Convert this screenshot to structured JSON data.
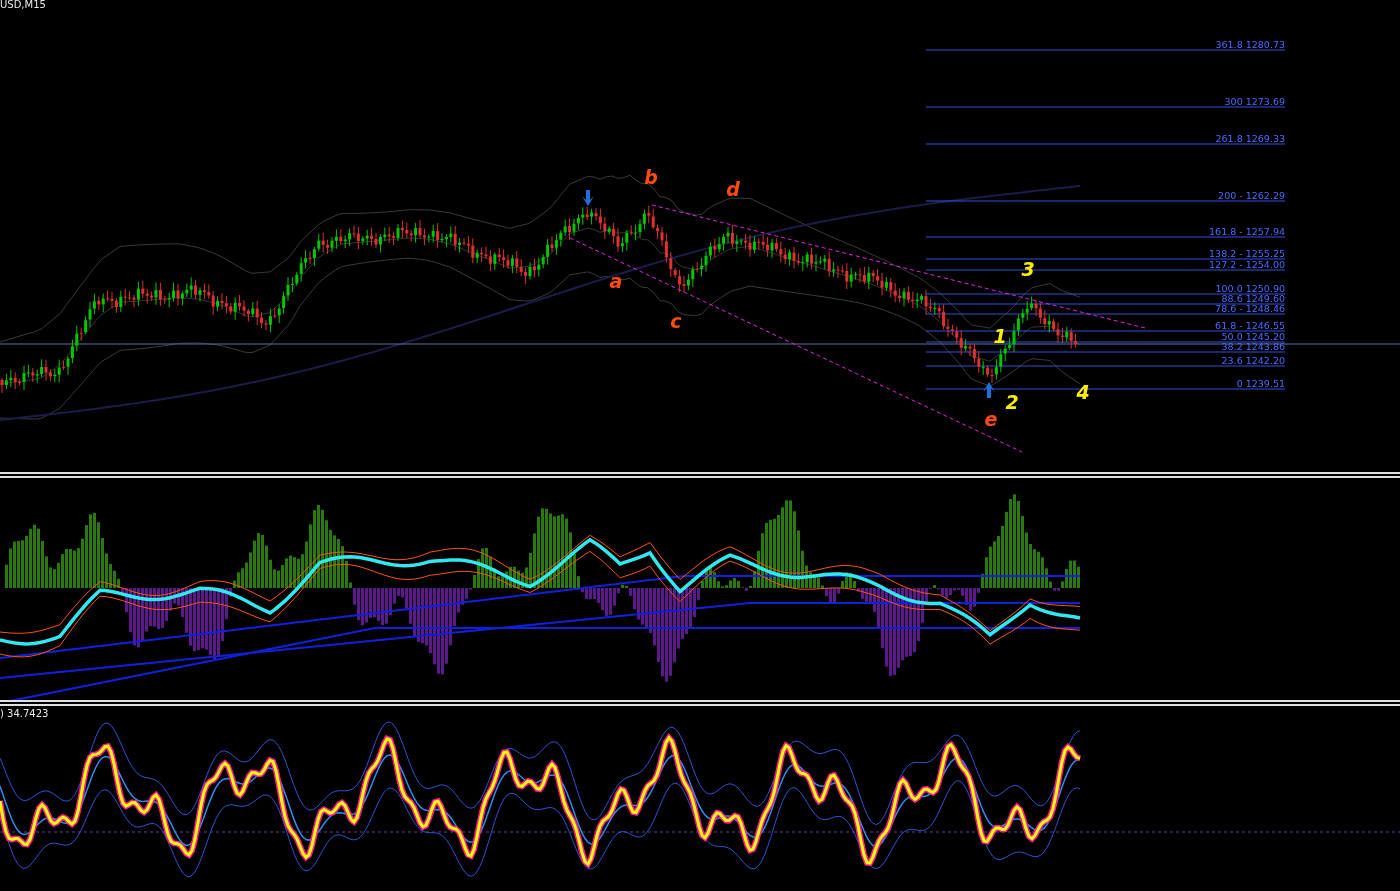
{
  "price_chart": {
    "symbol_label": "USD,M15",
    "fibonacci_levels": [
      {
        "label": "361.8 1280.73"
      },
      {
        "label": "300 1273.69"
      },
      {
        "label": "261.8 1269.33"
      },
      {
        "label": "200 - 1262.29"
      },
      {
        "label": "161.8 -  1257.94"
      },
      {
        "label": "138.2 - 1255.25"
      },
      {
        "label": "127.2 - 1254.00"
      },
      {
        "label": "100.0 1250.90"
      },
      {
        "label": "88.6 1249.60"
      },
      {
        "label": "78.6 - 1248.46"
      },
      {
        "label": "61.8 - 1246.55"
      },
      {
        "label": "50.0 1245.20"
      },
      {
        "label": "38.2 1243.86"
      },
      {
        "label": "23.6 1242.20"
      },
      {
        "label": "0 1239.51"
      }
    ],
    "wave_labels": [
      {
        "text": "b",
        "kind": "correction"
      },
      {
        "text": "d",
        "kind": "correction"
      },
      {
        "text": "a",
        "kind": "correction"
      },
      {
        "text": "c",
        "kind": "correction"
      },
      {
        "text": "e",
        "kind": "correction"
      },
      {
        "text": "1",
        "kind": "impulse"
      },
      {
        "text": "2",
        "kind": "impulse"
      },
      {
        "text": "3",
        "kind": "impulse"
      },
      {
        "text": "4",
        "kind": "impulse"
      }
    ]
  },
  "oscillator": {
    "value_label": ") 34.7423"
  }
}
